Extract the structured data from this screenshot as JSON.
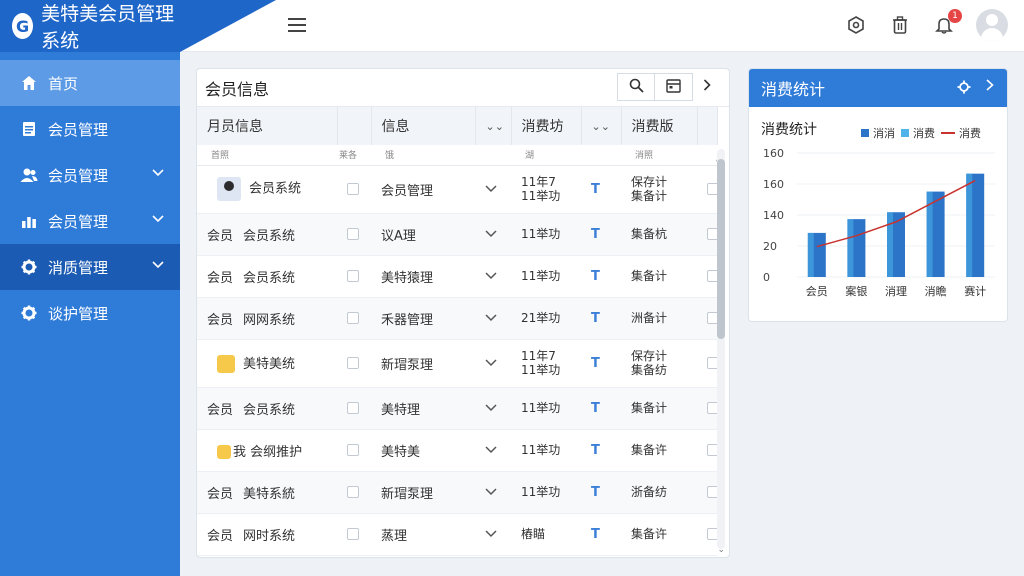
{
  "app": {
    "title": "美特美会员管理系统",
    "logo_letter": "G"
  },
  "sidebar": {
    "items": [
      {
        "label": "首页",
        "icon": "home-icon",
        "has_chevron": false
      },
      {
        "label": "会员管理",
        "icon": "document-icon",
        "has_chevron": false
      },
      {
        "label": "会员管理",
        "icon": "users-icon",
        "has_chevron": true
      },
      {
        "label": "会员管理",
        "icon": "chart-bars-icon",
        "has_chevron": true
      },
      {
        "label": "消质管理",
        "icon": "gear-icon",
        "has_chevron": true
      },
      {
        "label": "谈护管理",
        "icon": "gear-icon",
        "has_chevron": false
      }
    ]
  },
  "topbar": {
    "notification_count": "1"
  },
  "main": {
    "title": "会员信息",
    "columns": [
      "月员信息",
      "信息",
      "消费坊",
      "消费版"
    ],
    "subheaders": [
      "首照",
      "莱各",
      "饿",
      "湖",
      "消照"
    ],
    "rows": [
      {
        "c1": "",
        "c2": "会员系统",
        "icon": "avatar",
        "c3": "会员管理",
        "c4": "11年7\n11举功",
        "c5": "T",
        "c6": "保存计\n集备计"
      },
      {
        "c1": "会员",
        "c2": "会员系统",
        "icon": "",
        "c3": "议A理",
        "c4": "11举功",
        "c5": "T",
        "c6": "集备杭"
      },
      {
        "c1": "会员",
        "c2": "会员系统",
        "icon": "",
        "c3": "美特猿理",
        "c4": "11举功",
        "c5": "T",
        "c6": "集备计"
      },
      {
        "c1": "会员",
        "c2": "网网系统",
        "icon": "",
        "c3": "禾器管理",
        "c4": "21举功",
        "c5": "T",
        "c6": "洲备计"
      },
      {
        "c1": "",
        "c2": "美特美统",
        "icon": "yellow",
        "c3": "新瑁泵理",
        "c4": "11年7\n11举功",
        "c5": "T",
        "c6": "保存计\n集备纺"
      },
      {
        "c1": "会员",
        "c2": "会员系统",
        "icon": "",
        "c3": "美特理",
        "c4": "11举功",
        "c5": "T",
        "c6": "集备计"
      },
      {
        "c1": "",
        "c2": "我 会纲推护",
        "icon": "yellow-doc",
        "c3": "美特美",
        "c4": "11举功",
        "c5": "T",
        "c6": "集备许"
      },
      {
        "c1": "会员",
        "c2": "美特系統",
        "icon": "",
        "c3": "新瑁泵理",
        "c4": "11举功",
        "c5": "T",
        "c6": "浙备纺"
      },
      {
        "c1": "会员",
        "c2": "网时系统",
        "icon": "",
        "c3": "蒸理",
        "c4": "樁瞄",
        "c5": "T",
        "c6": "集备许"
      }
    ]
  },
  "chart_panel": {
    "title": "消费统计",
    "subtitle": "消费统计",
    "legend": [
      "消消",
      "消费",
      "消费"
    ],
    "colors": {
      "bar_dark": "#2b74c8",
      "bar_light": "#4fb3ea",
      "line": "#c8332e"
    }
  },
  "chart_data": {
    "type": "bar",
    "categories": [
      "会员",
      "案银",
      "消理",
      "消瞻",
      "赛计"
    ],
    "series": [
      {
        "name": "消消",
        "values": [
          32,
          42,
          47,
          62,
          75
        ]
      },
      {
        "name": "消费",
        "values": [
          22,
          30,
          40,
          55,
          70
        ]
      }
    ],
    "yticks": [
      "160",
      "160",
      "140",
      "20",
      "0"
    ],
    "ylim": [
      0,
      90
    ]
  }
}
